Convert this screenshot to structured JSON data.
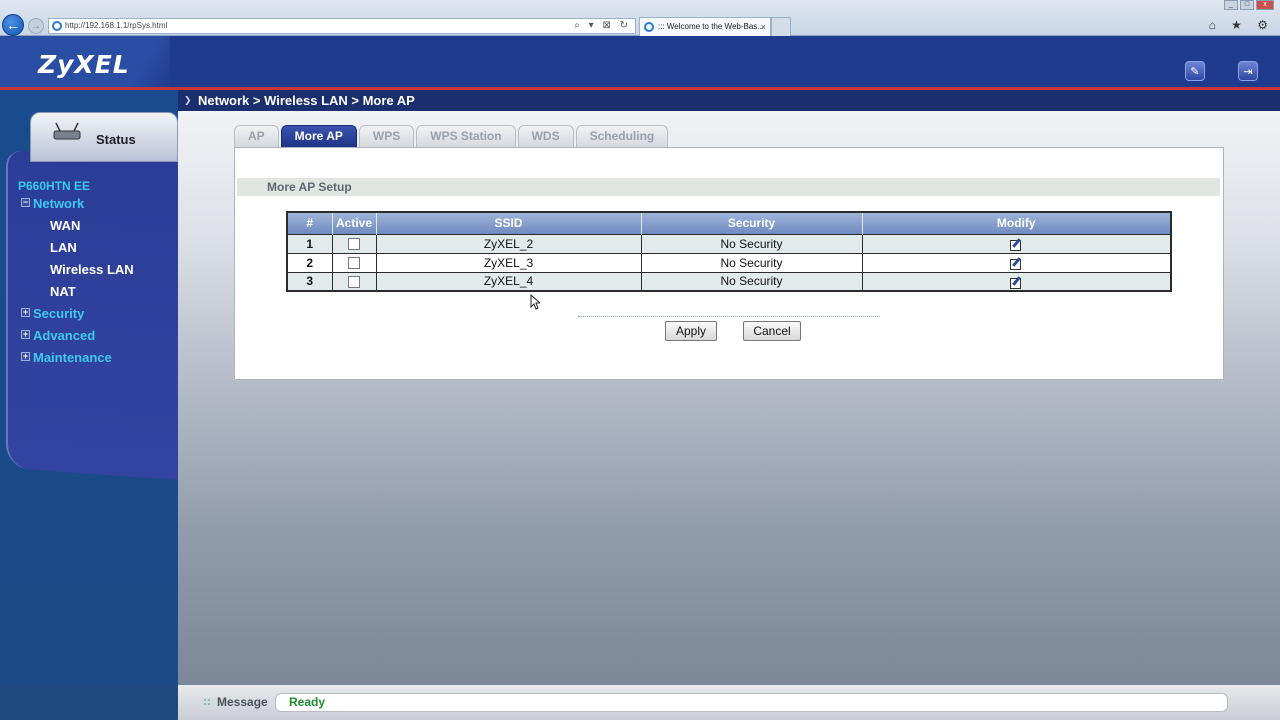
{
  "browser": {
    "address": "http://192.168.1.1/rpSys.html",
    "tab_title": "::: Welcome to the Web-Bas...",
    "tab_close": "×",
    "back_glyph": "←",
    "forward_glyph": "→",
    "address_tools": "⌕ ▾ ⊠ ↻",
    "icons": "⌂ ★ ⚙"
  },
  "header": {
    "logo": "ZyXEL"
  },
  "breadcrumb": "Network > Wireless LAN > More AP",
  "sidebar": {
    "status_label": "Status",
    "device": "P660HTN EE",
    "network": "Network",
    "network_box": "−",
    "items": [
      "WAN",
      "LAN",
      "Wireless LAN",
      "NAT"
    ],
    "security": "Security",
    "advanced": "Advanced",
    "maintenance": "Maintenance",
    "plus": "+"
  },
  "tabs": [
    "AP",
    "More AP",
    "WPS",
    "WPS Station",
    "WDS",
    "Scheduling"
  ],
  "section_title": "More AP Setup",
  "table": {
    "headers": [
      "#",
      "Active",
      "SSID",
      "Security",
      "Modify"
    ],
    "rows": [
      {
        "num": "1",
        "ssid": "ZyXEL_2",
        "security": "No Security"
      },
      {
        "num": "2",
        "ssid": "ZyXEL_3",
        "security": "No Security"
      },
      {
        "num": "3",
        "ssid": "ZyXEL_4",
        "security": "No Security"
      }
    ]
  },
  "buttons": {
    "apply": "Apply",
    "cancel": "Cancel"
  },
  "statusbar": {
    "label": "Message",
    "value": "Ready"
  },
  "colors": {
    "accent": "#1f3b8d",
    "red_line": "#c9343a",
    "menu_cyan": "#3fc8f0",
    "ready_green": "#1e8a2e"
  }
}
